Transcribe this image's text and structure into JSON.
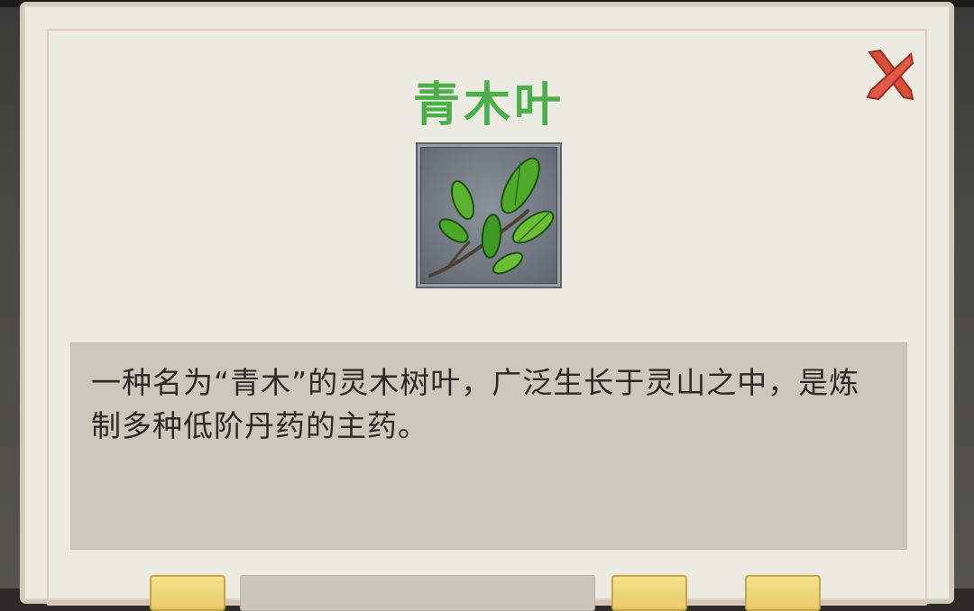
{
  "dialog": {
    "title": "青木叶",
    "item_name": "青木叶",
    "description": "一种名为“青木”的灵木树叶，广泛生长于灵山之中，是炼制多种低阶丹药的主药。"
  },
  "icons": {
    "close": "close-icon",
    "item": "leaf-icon"
  },
  "colors": {
    "title": "#4bb04a",
    "panel_bg": "#ecebe2",
    "desc_bg": "#cac7bc",
    "close": "#d94d3a",
    "button_gold": "#f0d978"
  }
}
